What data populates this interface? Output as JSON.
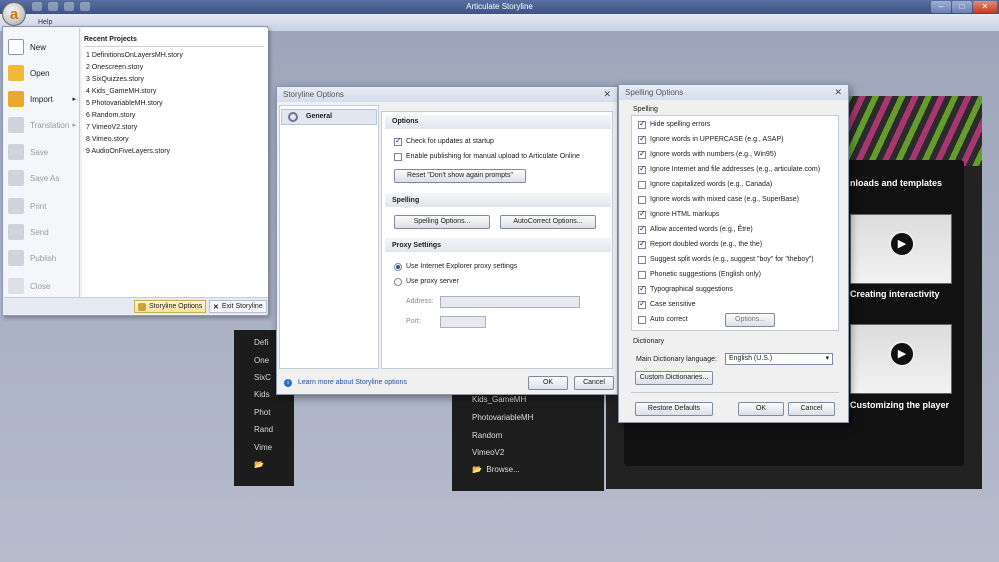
{
  "app": {
    "title": "Articulate Storyline",
    "logo_letter": "a",
    "help_tab": "Help"
  },
  "window_buttons": {
    "minimize": "–",
    "maximize": "□",
    "close": "✕"
  },
  "backstage": {
    "commands": [
      {
        "label": "New",
        "enabled": true,
        "icon": "new-document-icon"
      },
      {
        "label": "Open",
        "enabled": true,
        "icon": "open-folder-icon"
      },
      {
        "label": "Import",
        "enabled": true,
        "icon": "import-folder-icon",
        "submenu": "▸"
      },
      {
        "label": "Translation",
        "enabled": false,
        "icon": "translation-icon",
        "submenu": "▸"
      },
      {
        "label": "Save",
        "enabled": false,
        "icon": "save-icon"
      },
      {
        "label": "Save As",
        "enabled": false,
        "icon": "save-as-icon"
      },
      {
        "label": "Print",
        "enabled": false,
        "icon": "print-icon"
      },
      {
        "label": "Send",
        "enabled": false,
        "icon": "send-icon"
      },
      {
        "label": "Publish",
        "enabled": false,
        "icon": "publish-icon"
      },
      {
        "label": "Close",
        "enabled": false,
        "icon": "close-doc-icon"
      }
    ],
    "recent_header": "Recent Projects",
    "recent": [
      "1  DefinitionsOnLayersMH.story",
      "2  Onescreen.story",
      "3  SixQuizzes.story",
      "4  Kids_GameMH.story",
      "5  PhotovariableMH.story",
      "6  Random.story",
      "7  VimeoV2.story",
      "8  Vimeo.story",
      "9  AudioOnFiveLayers.story"
    ],
    "footer": {
      "options": "Storyline Options",
      "exit": "Exit Storyline",
      "exit_icon": "✕"
    }
  },
  "background": {
    "left_list": [
      "Defi",
      "One",
      "SixC",
      "Kids",
      "Phot",
      "Rand",
      "Vime"
    ],
    "mid_list": [
      "Kids_GameMH",
      "PhotovariableMH",
      "Random",
      "VimeoV2",
      "Browse..."
    ],
    "tutorials": [
      "nloads and templates",
      "Creating interactivity",
      "Customizing the player"
    ],
    "play_glyph": "▶"
  },
  "storyline_options": {
    "title": "Storyline Options",
    "close_glyph": "✕",
    "nav_item": "General",
    "options_header": "Options",
    "check_updates": {
      "label": "Check for updates at startup",
      "checked": true
    },
    "enable_publishing": {
      "label": "Enable publishing for manual upload to Articulate Online",
      "checked": false
    },
    "reset_button": "Reset \"Don't show again prompts\"",
    "spelling_header": "Spelling",
    "spelling_options_button": "Spelling Options...",
    "autocorrect_button": "AutoCorrect Options...",
    "proxy_header": "Proxy Settings",
    "proxy_ie": {
      "label": "Use Internet Explorer proxy settings",
      "selected": true
    },
    "proxy_server": {
      "label": "Use proxy server",
      "selected": false
    },
    "address_label": "Address:",
    "port_label": "Port:",
    "address_value": "",
    "port_value": "",
    "learn_more": "Learn more about Storyline options",
    "ok": "OK",
    "cancel": "Cancel"
  },
  "spelling_options": {
    "title": "Spelling Options",
    "close_glyph": "✕",
    "spelling_header": "Spelling",
    "items": [
      {
        "label": "Hide spelling errors",
        "checked": true
      },
      {
        "label": "Ignore words in UPPERCASE (e.g., ASAP)",
        "checked": true
      },
      {
        "label": "Ignore words with numbers (e.g., Win95)",
        "checked": true
      },
      {
        "label": "Ignore Internet and file addresses (e.g., articulate.com)",
        "checked": true
      },
      {
        "label": "Ignore capitalized words (e.g., Canada)",
        "checked": false
      },
      {
        "label": "Ignore words with mixed case (e.g., SuperBase)",
        "checked": false
      },
      {
        "label": "Ignore HTML markups",
        "checked": true
      },
      {
        "label": "Allow accented words (e.g., Être)",
        "checked": true
      },
      {
        "label": "Report doubled words (e.g., the the)",
        "checked": true
      },
      {
        "label": "Suggest split words (e.g., suggest \"boy\" for \"theboy\")",
        "checked": false
      },
      {
        "label": "Phonetic suggestions (English only)",
        "checked": false
      },
      {
        "label": "Typographical suggestions",
        "checked": true
      },
      {
        "label": "Case sensitive",
        "checked": true
      },
      {
        "label": "Auto correct",
        "checked": false
      }
    ],
    "options_button": "Options...",
    "dictionary_header": "Dictionary",
    "main_dictionary_label": "Main Dictionary language:",
    "main_dictionary_value": "English (U.S.)",
    "custom_dictionaries_button": "Custom Dictionaries...",
    "restore_defaults": "Restore Defaults",
    "ok": "OK",
    "cancel": "Cancel"
  }
}
